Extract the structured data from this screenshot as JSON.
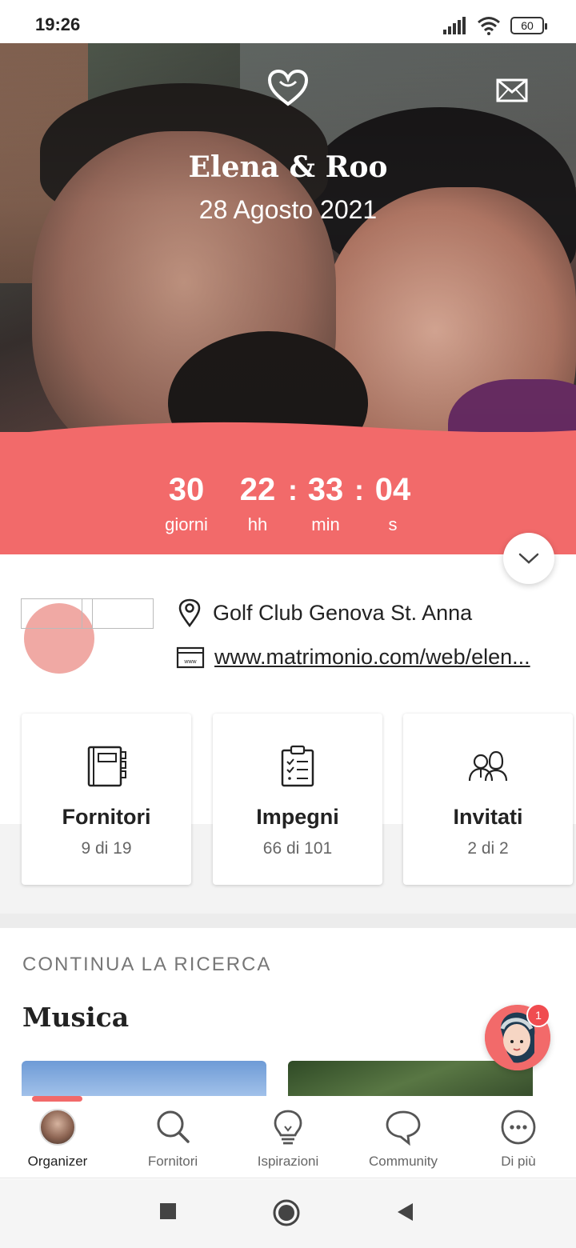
{
  "status_bar": {
    "time": "19:26",
    "battery": "60"
  },
  "hero": {
    "couple_name": "Elena & Roo",
    "wedding_date": "28 Agosto 2021"
  },
  "countdown": {
    "days": "30",
    "days_label": "giorni",
    "hours": "22",
    "hours_label": "hh",
    "minutes": "33",
    "minutes_label": "min",
    "seconds": "04",
    "seconds_label": "s",
    "separator": ":"
  },
  "info": {
    "venue": "Golf Club Genova St. Anna",
    "website": "www.matrimonio.com/web/elen..."
  },
  "cards": [
    {
      "title": "Fornitori",
      "subtitle": "9 di 19",
      "icon": "notebook-icon"
    },
    {
      "title": "Impegni",
      "subtitle": "66 di 101",
      "icon": "checklist-icon"
    },
    {
      "title": "Invitati",
      "subtitle": "2 di 2",
      "icon": "guests-icon"
    }
  ],
  "section": {
    "label": "CONTINUA LA RICERCA",
    "title": "Musica"
  },
  "assistant": {
    "badge": "1"
  },
  "bottom_nav": [
    {
      "label": "Organizer",
      "icon": "avatar",
      "active": true
    },
    {
      "label": "Fornitori",
      "icon": "search-icon"
    },
    {
      "label": "Ispirazioni",
      "icon": "lightbulb-icon"
    },
    {
      "label": "Community",
      "icon": "chat-bubble-icon"
    },
    {
      "label": "Di più",
      "icon": "more-icon"
    }
  ],
  "colors": {
    "accent": "#f26a6a",
    "text": "#222222",
    "muted": "#666666"
  }
}
